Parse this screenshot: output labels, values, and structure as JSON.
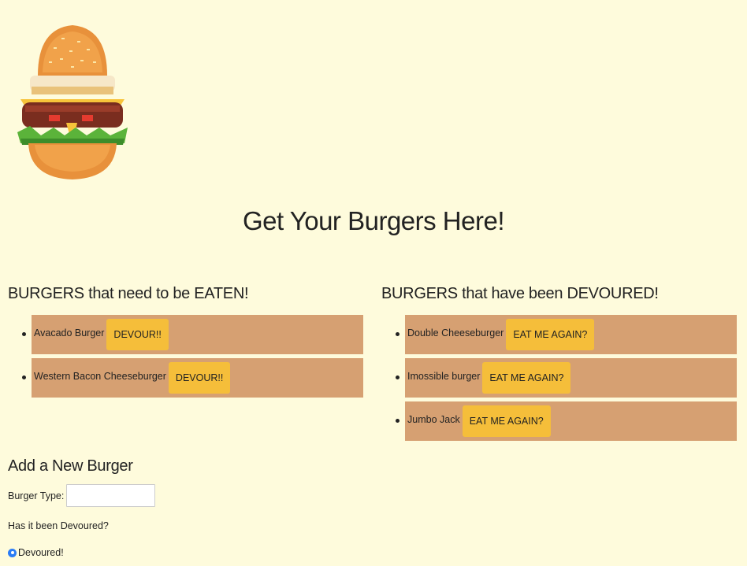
{
  "page": {
    "title": "Get Your Burgers Here!"
  },
  "to_eat": {
    "heading": "BURGERS that need to be EATEN!",
    "button_label": "DEVOUR!!",
    "items": [
      {
        "name": "Avacado Burger"
      },
      {
        "name": "Western Bacon Cheeseburger"
      }
    ]
  },
  "devoured": {
    "heading": "BURGERS that have been DEVOURED!",
    "button_label": "EAT ME AGAIN?",
    "items": [
      {
        "name": "Double Cheeseburger"
      },
      {
        "name": "Imossible burger"
      },
      {
        "name": "Jumbo Jack"
      }
    ]
  },
  "form": {
    "heading": "Add a New Burger",
    "type_label": "Burger Type:",
    "type_value": "",
    "devoured_question": "Has it been Devoured?",
    "radio_label": "Devoured!"
  },
  "colors": {
    "background": "#fefbdc",
    "card": "#d6a072",
    "button": "#f5be3a",
    "radio": "#2a7cf6"
  },
  "logo_icon": "burger-icon"
}
